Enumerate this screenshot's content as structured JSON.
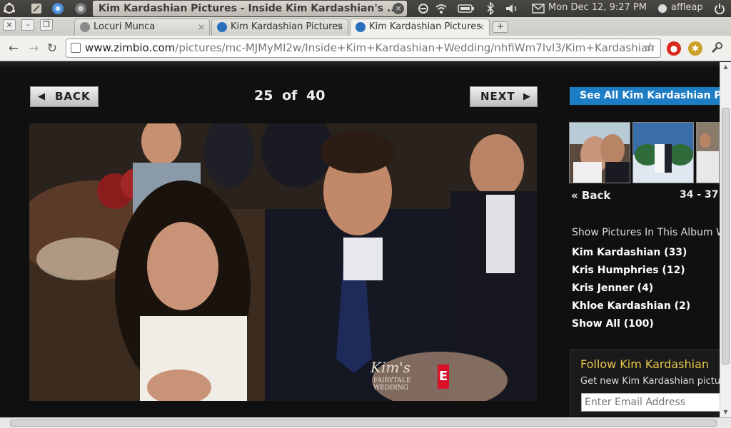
{
  "panel": {
    "window_title": "Kim Kardashian Pictures - Inside Kim Kardashian's ...",
    "clock": "Mon Dec 12,  9:27 PM",
    "user": "affleap"
  },
  "tabs": [
    {
      "label": "Locuri Munca",
      "close": "×"
    },
    {
      "label": "Kim Kardashian Pictures",
      "close": "×"
    },
    {
      "label": "Kim Kardashian Pictures",
      "close": "×"
    }
  ],
  "window_controls": {
    "close": "×",
    "minimize": "–",
    "restore": "❐"
  },
  "new_tab": "+",
  "toolbar": {
    "back": "←",
    "forward": "→",
    "reload": "↻",
    "url_domain": "www.zimbio.com",
    "url_path": "/pictures/mc-MJMyMI2w/Inside+Kim+Kardashian+Wedding/nhfiWm7Ivl3/Kim+Kardashian",
    "star": "☆",
    "wrench": "🔧"
  },
  "gallery": {
    "back_label": "BACK",
    "next_label": "NEXT",
    "counter_current": "25",
    "counter_of": "of",
    "counter_total": "40",
    "photo_watermark_script": "Kim's",
    "photo_watermark_line": "FAIRYTALE WEDDING",
    "photo_watermark_logo": "E"
  },
  "sidebar": {
    "see_all": "See All Kim Kardashian Pics",
    "back": "« Back",
    "range": "34 - 37",
    "album_heading": "Show Pictures In This Album With",
    "album_links": [
      "Kim Kardashian (33)",
      "Kris Humphries (12)",
      "Kris Jenner (4)",
      "Khloe Kardashian (2)",
      "Show All (100)"
    ],
    "follow_title": "Follow Kim Kardashian",
    "follow_sub": "Get new Kim Kardashian pictures",
    "email_placeholder": "Enter Email Address"
  },
  "colors": {
    "accent_blue": "#1c7cc4",
    "follow_gold": "#e8c84a",
    "page_bg": "#101010"
  }
}
